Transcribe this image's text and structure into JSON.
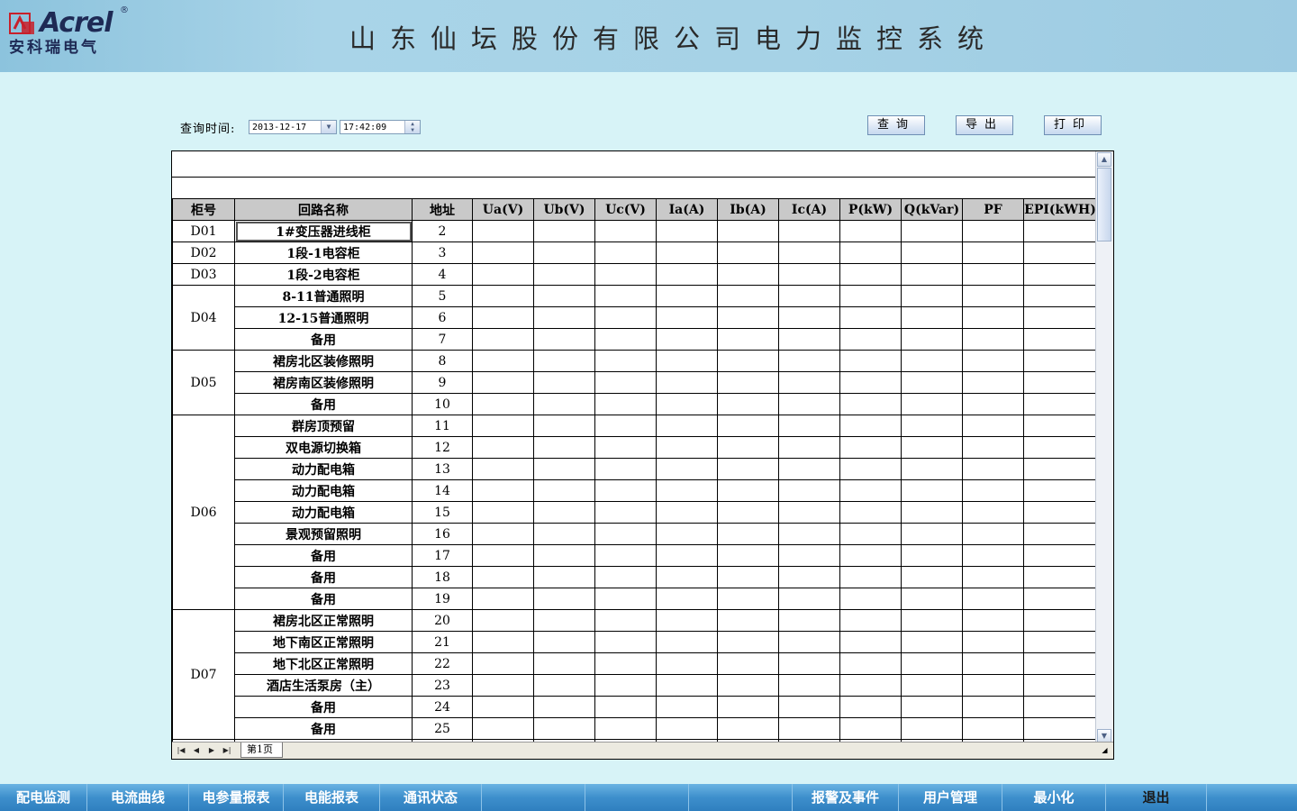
{
  "header": {
    "brand": "Acrel",
    "brand_reg": "®",
    "brand_cn": "安科瑞电气",
    "system_title": "山东仙坛股份有限公司电力监控系统"
  },
  "query": {
    "label": "查询时间:",
    "date": "2013-12-17",
    "time": "17:42:09",
    "buttons": {
      "query": "查询",
      "export": "导出",
      "print": "打印"
    }
  },
  "table": {
    "columns": [
      "柜号",
      "回路名称",
      "地址",
      "Ua(V)",
      "Ub(V)",
      "Uc(V)",
      "Ia(A)",
      "Ib(A)",
      "Ic(A)",
      "P(kW)",
      "Q(kVar)",
      "PF",
      "EPI(kWH)"
    ],
    "groups": [
      {
        "cabinet": "D01",
        "rows": [
          {
            "name": "1#变压器进线柜",
            "addr": "2"
          }
        ]
      },
      {
        "cabinet": "D02",
        "rows": [
          {
            "name": "1段-1电容柜",
            "addr": "3"
          }
        ]
      },
      {
        "cabinet": "D03",
        "rows": [
          {
            "name": "1段-2电容柜",
            "addr": "4"
          }
        ]
      },
      {
        "cabinet": "D04",
        "rows": [
          {
            "name": "8-11普通照明",
            "addr": "5"
          },
          {
            "name": "12-15普通照明",
            "addr": "6"
          },
          {
            "name": "备用",
            "addr": "7"
          }
        ]
      },
      {
        "cabinet": "D05",
        "rows": [
          {
            "name": "裙房北区装修照明",
            "addr": "8"
          },
          {
            "name": "裙房南区装修照明",
            "addr": "9"
          },
          {
            "name": "备用",
            "addr": "10"
          }
        ]
      },
      {
        "cabinet": "D06",
        "rows": [
          {
            "name": "群房顶预留",
            "addr": "11"
          },
          {
            "name": "双电源切换箱",
            "addr": "12"
          },
          {
            "name": "动力配电箱",
            "addr": "13"
          },
          {
            "name": "动力配电箱",
            "addr": "14"
          },
          {
            "name": "动力配电箱",
            "addr": "15"
          },
          {
            "name": "景观预留照明",
            "addr": "16"
          },
          {
            "name": "备用",
            "addr": "17"
          },
          {
            "name": "备用",
            "addr": "18"
          },
          {
            "name": "备用",
            "addr": "19"
          }
        ]
      },
      {
        "cabinet": "D07",
        "rows": [
          {
            "name": "裙房北区正常照明",
            "addr": "20"
          },
          {
            "name": "地下南区正常照明",
            "addr": "21"
          },
          {
            "name": "地下北区正常照明",
            "addr": "22"
          },
          {
            "name": "酒店生活泵房（主）",
            "addr": "23"
          },
          {
            "name": "备用",
            "addr": "24"
          },
          {
            "name": "备用",
            "addr": "25"
          }
        ]
      }
    ],
    "sheet_tab": "第1页",
    "selected_row": 0
  },
  "bottom_nav": {
    "items": [
      {
        "label": "配电监测"
      },
      {
        "label": "电流曲线"
      },
      {
        "label": "电参量报表"
      },
      {
        "label": "电能报表"
      },
      {
        "label": "通讯状态"
      },
      {
        "label": ""
      },
      {
        "label": ""
      },
      {
        "label": ""
      },
      {
        "label": "报警及事件"
      },
      {
        "label": "用户管理"
      },
      {
        "label": "最小化"
      },
      {
        "label": "退出"
      }
    ]
  }
}
